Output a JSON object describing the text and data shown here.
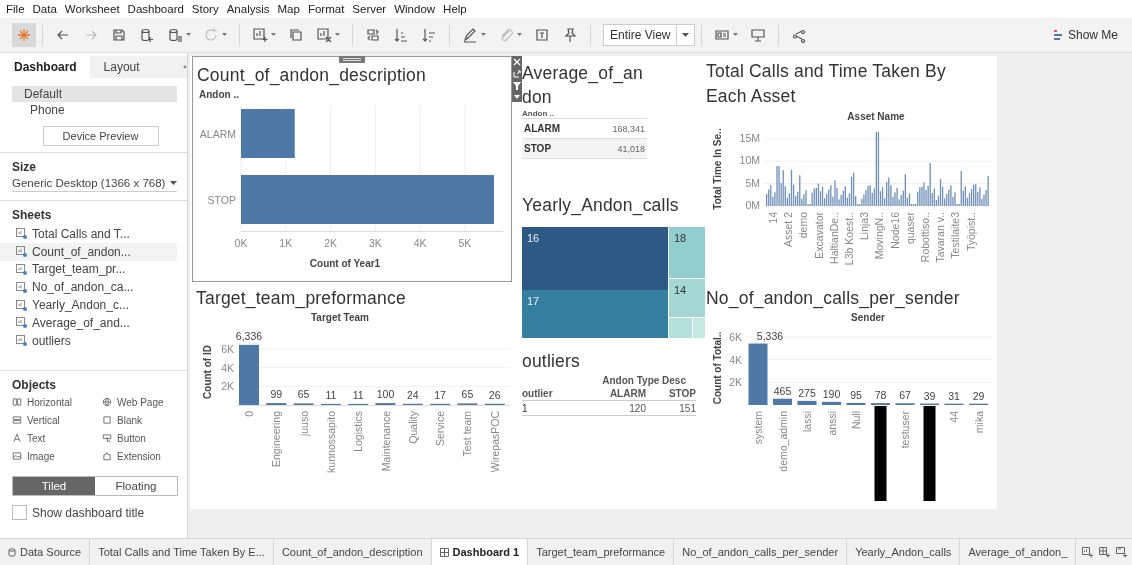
{
  "menu": [
    "File",
    "Data",
    "Worksheet",
    "Dashboard",
    "Story",
    "Analysis",
    "Map",
    "Format",
    "Server",
    "Window",
    "Help"
  ],
  "toolbar": {
    "view_mode": "Entire View",
    "show_me": "Show Me"
  },
  "side_panel": {
    "tabs": [
      {
        "label": "Dashboard",
        "selected": true
      },
      {
        "label": "Layout",
        "selected": false
      }
    ],
    "devices": [
      {
        "label": "Default",
        "selected": true
      },
      {
        "label": "Phone",
        "selected": false
      }
    ],
    "device_preview": "Device Preview",
    "size": {
      "title": "Size",
      "value": "Generic Desktop (1366 x 768)"
    },
    "sheets": {
      "title": "Sheets",
      "items": [
        {
          "label": "Total Calls and T...",
          "selected": false
        },
        {
          "label": "Count_of_andon...",
          "selected": true
        },
        {
          "label": "Target_team_pr...",
          "selected": false
        },
        {
          "label": "No_of_andon_ca...",
          "selected": false
        },
        {
          "label": "Yearly_Andon_c...",
          "selected": false
        },
        {
          "label": "Average_of_and...",
          "selected": false
        },
        {
          "label": "outliers",
          "selected": false
        }
      ]
    },
    "objects": {
      "title": "Objects",
      "items": [
        "Horizontal",
        "Web Page",
        "Vertical",
        "Blank",
        "Text",
        "Button",
        "Image",
        "Extension"
      ]
    },
    "layout_mode": [
      {
        "label": "Tiled",
        "selected": true
      },
      {
        "label": "Floating",
        "selected": false
      }
    ],
    "show_title": {
      "label": "Show dashboard title",
      "checked": false
    }
  },
  "dashboard": {
    "count_chart": {
      "selected": true,
      "chart_data": {
        "type": "bar",
        "orientation": "horizontal",
        "title": "Count_of_andon_description",
        "ylabel": "Andon ..",
        "xlabel": "Count of Year1",
        "categories": [
          "ALARM",
          "STOP"
        ],
        "values": [
          1200,
          5650
        ],
        "grid": true,
        "xlim": [
          0,
          5850
        ],
        "xticks": [
          {
            "value": 0,
            "label": "0K"
          },
          {
            "value": 1000,
            "label": "1K"
          },
          {
            "value": 2000,
            "label": "2K"
          },
          {
            "value": 3000,
            "label": "3K"
          },
          {
            "value": 4000,
            "label": "4K"
          },
          {
            "value": 5000,
            "label": "5K"
          }
        ]
      }
    },
    "target_chart": {
      "chart_data": {
        "type": "bar",
        "title": "Target_team_preformance",
        "xlabel": "Target Team",
        "ylabel": "Count of ID",
        "categories": [
          "0",
          "Engineering",
          "juuso",
          "kunnossapito",
          "Logistics",
          "Maintenance",
          "Quality",
          "Service",
          "Test team",
          "WirepasPOC"
        ],
        "values": [
          6336,
          99,
          65,
          11,
          11,
          100,
          24,
          17,
          65,
          26
        ],
        "ylim": [
          0,
          6640
        ],
        "yticks": [
          {
            "value": 2000,
            "label": "2K"
          },
          {
            "value": 4000,
            "label": "4K"
          },
          {
            "value": 6000,
            "label": "6K"
          }
        ],
        "grid": true,
        "value_labels": [
          "6,336",
          "99",
          "65",
          "11",
          "11",
          "100",
          "24",
          "17",
          "65",
          "26"
        ]
      }
    },
    "asset_chart": {
      "title": "Total Calls and Time Taken By Each Asset",
      "header": "Asset Name",
      "y_title": "Total Time In Se..",
      "y_ticks": [
        "15M",
        "10M",
        "5M",
        "0M"
      ],
      "x_labels": [
        "14",
        "Asset 2",
        "demo",
        "Excavator",
        "HaltianDe..",
        "L3b Koest..",
        "Linja3",
        "MovingN..",
        "Node16",
        "quaser",
        "Robottiso..",
        "Tavaran v..",
        "Testilaite3",
        "Työpist.."
      ]
    },
    "sender_chart": {
      "chart_data": {
        "type": "bar",
        "title": "No_of_andon_calls_per_sender",
        "xlabel": "Sender",
        "ylabel": "Count of Total..",
        "categories": [
          "system",
          "demo_admin",
          "lassi",
          "anssi",
          "Null",
          null,
          "testuser",
          null,
          "44",
          "mika"
        ],
        "values": [
          5336,
          465,
          275,
          190,
          95,
          78,
          67,
          39,
          31,
          29
        ],
        "ylim": [
          0,
          6000
        ],
        "yticks": [
          {
            "value": 2000,
            "label": "2K"
          },
          {
            "value": 4000,
            "label": "4K"
          },
          {
            "value": 6000,
            "label": "6K"
          }
        ],
        "grid": true,
        "value_labels": [
          "5,336",
          "465",
          "275",
          "190",
          "95",
          "78",
          "67",
          "39",
          "31",
          "29"
        ]
      }
    },
    "average_table": {
      "title": "Average_of_andon",
      "header": "Andon ..",
      "rows": [
        {
          "label": "ALARM",
          "value": "168,341"
        },
        {
          "label": "STOP",
          "value": "41,018"
        }
      ]
    },
    "yearly_treemap": {
      "title": "Yearly_Andon_calls",
      "cells": [
        {
          "label": "16",
          "color": "#2d5986"
        },
        {
          "label": "17",
          "color": "#357fa0"
        },
        {
          "label": "18",
          "color": "#92cdd0"
        },
        {
          "label": "14",
          "color": "#a3d8d4"
        },
        {
          "color": "#b3e1d9"
        },
        {
          "color": "#c2e8df"
        }
      ]
    },
    "outliers_table": {
      "title": "outliers",
      "group_header": "Andon Type Desc",
      "columns": [
        "outlier",
        "ALARM",
        "STOP"
      ],
      "rows": [
        [
          "1",
          "120",
          "151"
        ]
      ]
    }
  },
  "sheet_tabs": [
    {
      "label": "Data Source",
      "kind": "data",
      "selected": false
    },
    {
      "label": "Total Calls and Time Taken By E...",
      "kind": "sheet",
      "selected": false
    },
    {
      "label": "Count_of_andon_description",
      "kind": "sheet",
      "selected": false
    },
    {
      "label": "Dashboard 1",
      "kind": "dashboard",
      "selected": true
    },
    {
      "label": "Target_team_preformance",
      "kind": "sheet",
      "selected": false
    },
    {
      "label": "No_of_andon_calls_per_sender",
      "kind": "sheet",
      "selected": false
    },
    {
      "label": "Yearly_Andon_calls",
      "kind": "sheet",
      "selected": false
    },
    {
      "label": "Average_of_andon_",
      "kind": "sheet",
      "selected": false
    }
  ]
}
